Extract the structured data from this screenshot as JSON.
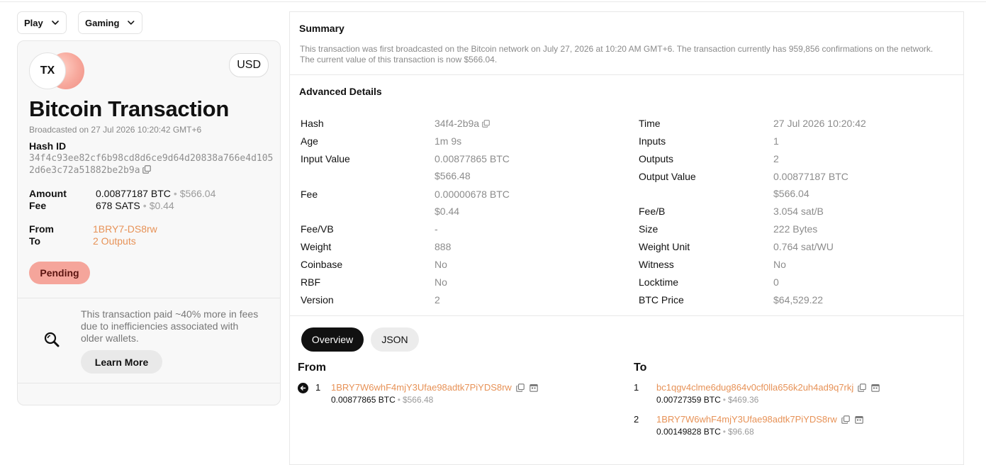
{
  "filters": {
    "play_label": "Play",
    "gaming_label": "Gaming"
  },
  "card": {
    "logo_text": "TX",
    "currency": "USD",
    "title": "Bitcoin Transaction",
    "broadcast": "Broadcasted on 27 Jul 2026 10:20:42 GMT+6",
    "hash_label": "Hash ID",
    "hash_id": "34f4c93ee82cf6b98cd8d6ce9d64d20838a766e4d1052d6e3c72a51882be2b9a",
    "amount_label": "Amount",
    "amount_btc": "0.00877187 BTC",
    "amount_usd": "$566.04",
    "fee_label": "Fee",
    "fee_sats": "678 SATS",
    "fee_usd": "$0.44",
    "from_label": "From",
    "from_value": "1BRY7-DS8rw",
    "to_label": "To",
    "to_value": "2 Outputs",
    "status": "Pending",
    "tip": "This transaction paid ~40% more in fees due to inefficiencies associated with older wallets.",
    "learn_more": "Learn More"
  },
  "summary": {
    "title": "Summary",
    "text": "This transaction was first broadcasted on the Bitcoin network on July 27, 2026 at 10:20 AM GMT+6. The transaction currently has 959,856 confirmations on the network. The current value of this transaction is now $566.04."
  },
  "advanced": {
    "title": "Advanced Details",
    "left": [
      {
        "label": "Hash",
        "value": "34f4-2b9a"
      },
      {
        "label": "Age",
        "value": "1m 9s"
      },
      {
        "label": "Input Value",
        "value": "0.00877865 BTC",
        "value2": "$566.48"
      },
      {
        "label": "Fee",
        "value": "0.00000678 BTC",
        "value2": "$0.44"
      },
      {
        "label": "Fee/VB",
        "value": "-"
      },
      {
        "label": "Weight",
        "value": "888"
      },
      {
        "label": "Coinbase",
        "value": "No"
      },
      {
        "label": "RBF",
        "value": "No"
      },
      {
        "label": "Version",
        "value": "2"
      }
    ],
    "right": [
      {
        "label": "Time",
        "value": "27 Jul 2026 10:20:42"
      },
      {
        "label": "Inputs",
        "value": "1"
      },
      {
        "label": "Outputs",
        "value": "2"
      },
      {
        "label": "Output Value",
        "value": "0.00877187 BTC",
        "value2": "$566.04"
      },
      {
        "label": "Fee/B",
        "value": "3.054 sat/B"
      },
      {
        "label": "Size",
        "value": "222 Bytes"
      },
      {
        "label": "Weight Unit",
        "value": "0.764 sat/WU"
      },
      {
        "label": "Witness",
        "value": "No"
      },
      {
        "label": "Locktime",
        "value": "0"
      },
      {
        "label": "BTC Price",
        "value": "$64,529.22"
      }
    ]
  },
  "tabs": {
    "overview": "Overview",
    "json": "JSON"
  },
  "from": {
    "title": "From",
    "items": [
      {
        "index": "1",
        "address": "1BRY7W6whF4mjY3Ufae98adtk7PiYDS8rw",
        "btc": "0.00877865 BTC",
        "usd": "$566.48"
      }
    ]
  },
  "to": {
    "title": "To",
    "items": [
      {
        "index": "1",
        "address": "bc1qgv4clme6dug864v0cf0lla656k2uh4ad9q7rkj",
        "btc": "0.00727359 BTC",
        "usd": "$469.36"
      },
      {
        "index": "2",
        "address": "1BRY7W6whF4mjY3Ufae98adtk7PiYDS8rw",
        "btc": "0.00149828 BTC",
        "usd": "$96.68"
      }
    ]
  }
}
